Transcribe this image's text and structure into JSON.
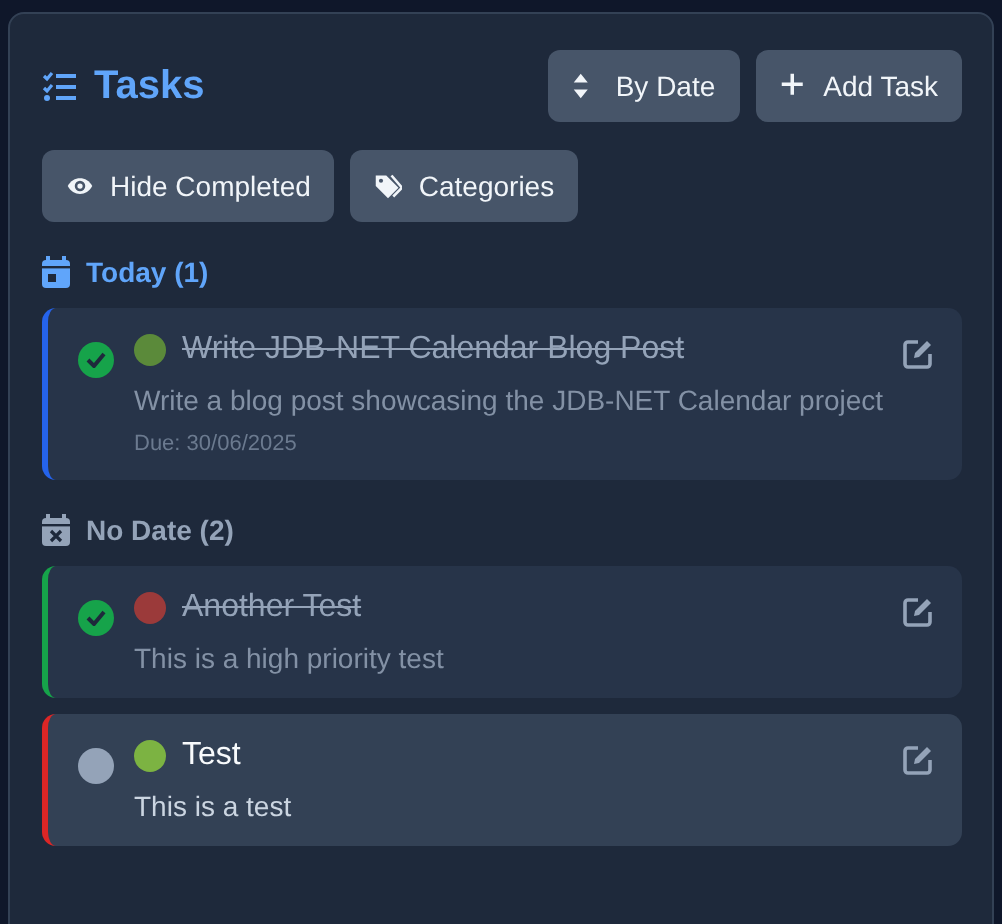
{
  "header": {
    "title": "Tasks",
    "buttons": [
      {
        "label": "By Date",
        "kind": "sort"
      },
      {
        "label": "Add Task",
        "kind": "add"
      }
    ]
  },
  "filters": [
    {
      "label": "Hide Completed",
      "kind": "eye"
    },
    {
      "label": "Categories",
      "kind": "tags"
    }
  ],
  "groups": [
    {
      "title": "Today (1)",
      "kind": "today",
      "tasks": [
        {
          "title": "Write JDB-NET Calendar Blog Post",
          "description": "Write a blog post showcasing the JDB-NET Calendar project",
          "due": "Due: 30/06/2025",
          "completed": true,
          "color": "#2563eb",
          "category": {
            "color": "#5b8a3a"
          }
        }
      ]
    },
    {
      "title": "No Date (2)",
      "kind": "none",
      "tasks": [
        {
          "title": "Another Test",
          "description": "This is a high priority test",
          "completed": true,
          "color": "#16a34a",
          "category": {
            "color": "#9b3a3a"
          }
        },
        {
          "title": "Test",
          "description": "This is a test",
          "completed": false,
          "color": "#dc2626",
          "category": {
            "color": "#7cb342"
          }
        }
      ]
    }
  ]
}
